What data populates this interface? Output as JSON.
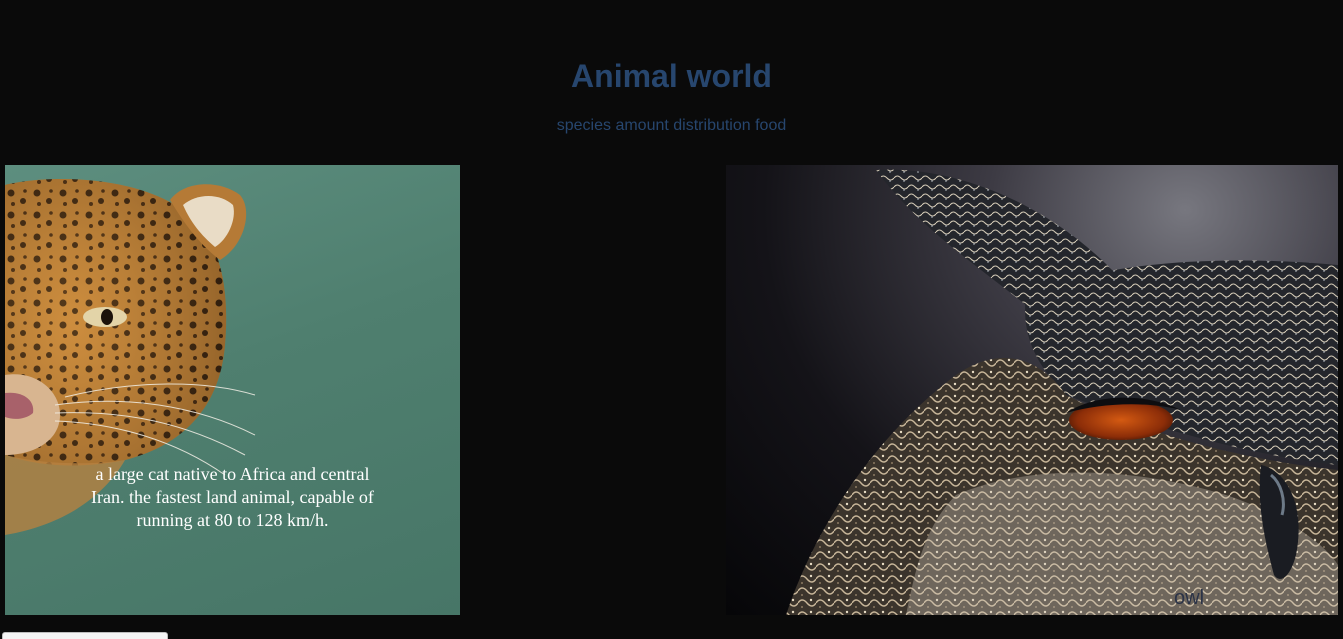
{
  "header": {
    "title": "Animal world",
    "nav": [
      "species",
      "amount",
      "distribution",
      "food"
    ]
  },
  "cards": {
    "leopard": {
      "image_subject": "leopard-image",
      "caption": "a large cat native to Africa and central Iran. the fastest land animal, capable of running at 80 to 128 km/h."
    },
    "owl": {
      "image_subject": "owl-image",
      "label": "owl"
    }
  },
  "colors": {
    "background": "#0a0a0a",
    "heading": "#27466e",
    "caption": "#ffffff"
  }
}
